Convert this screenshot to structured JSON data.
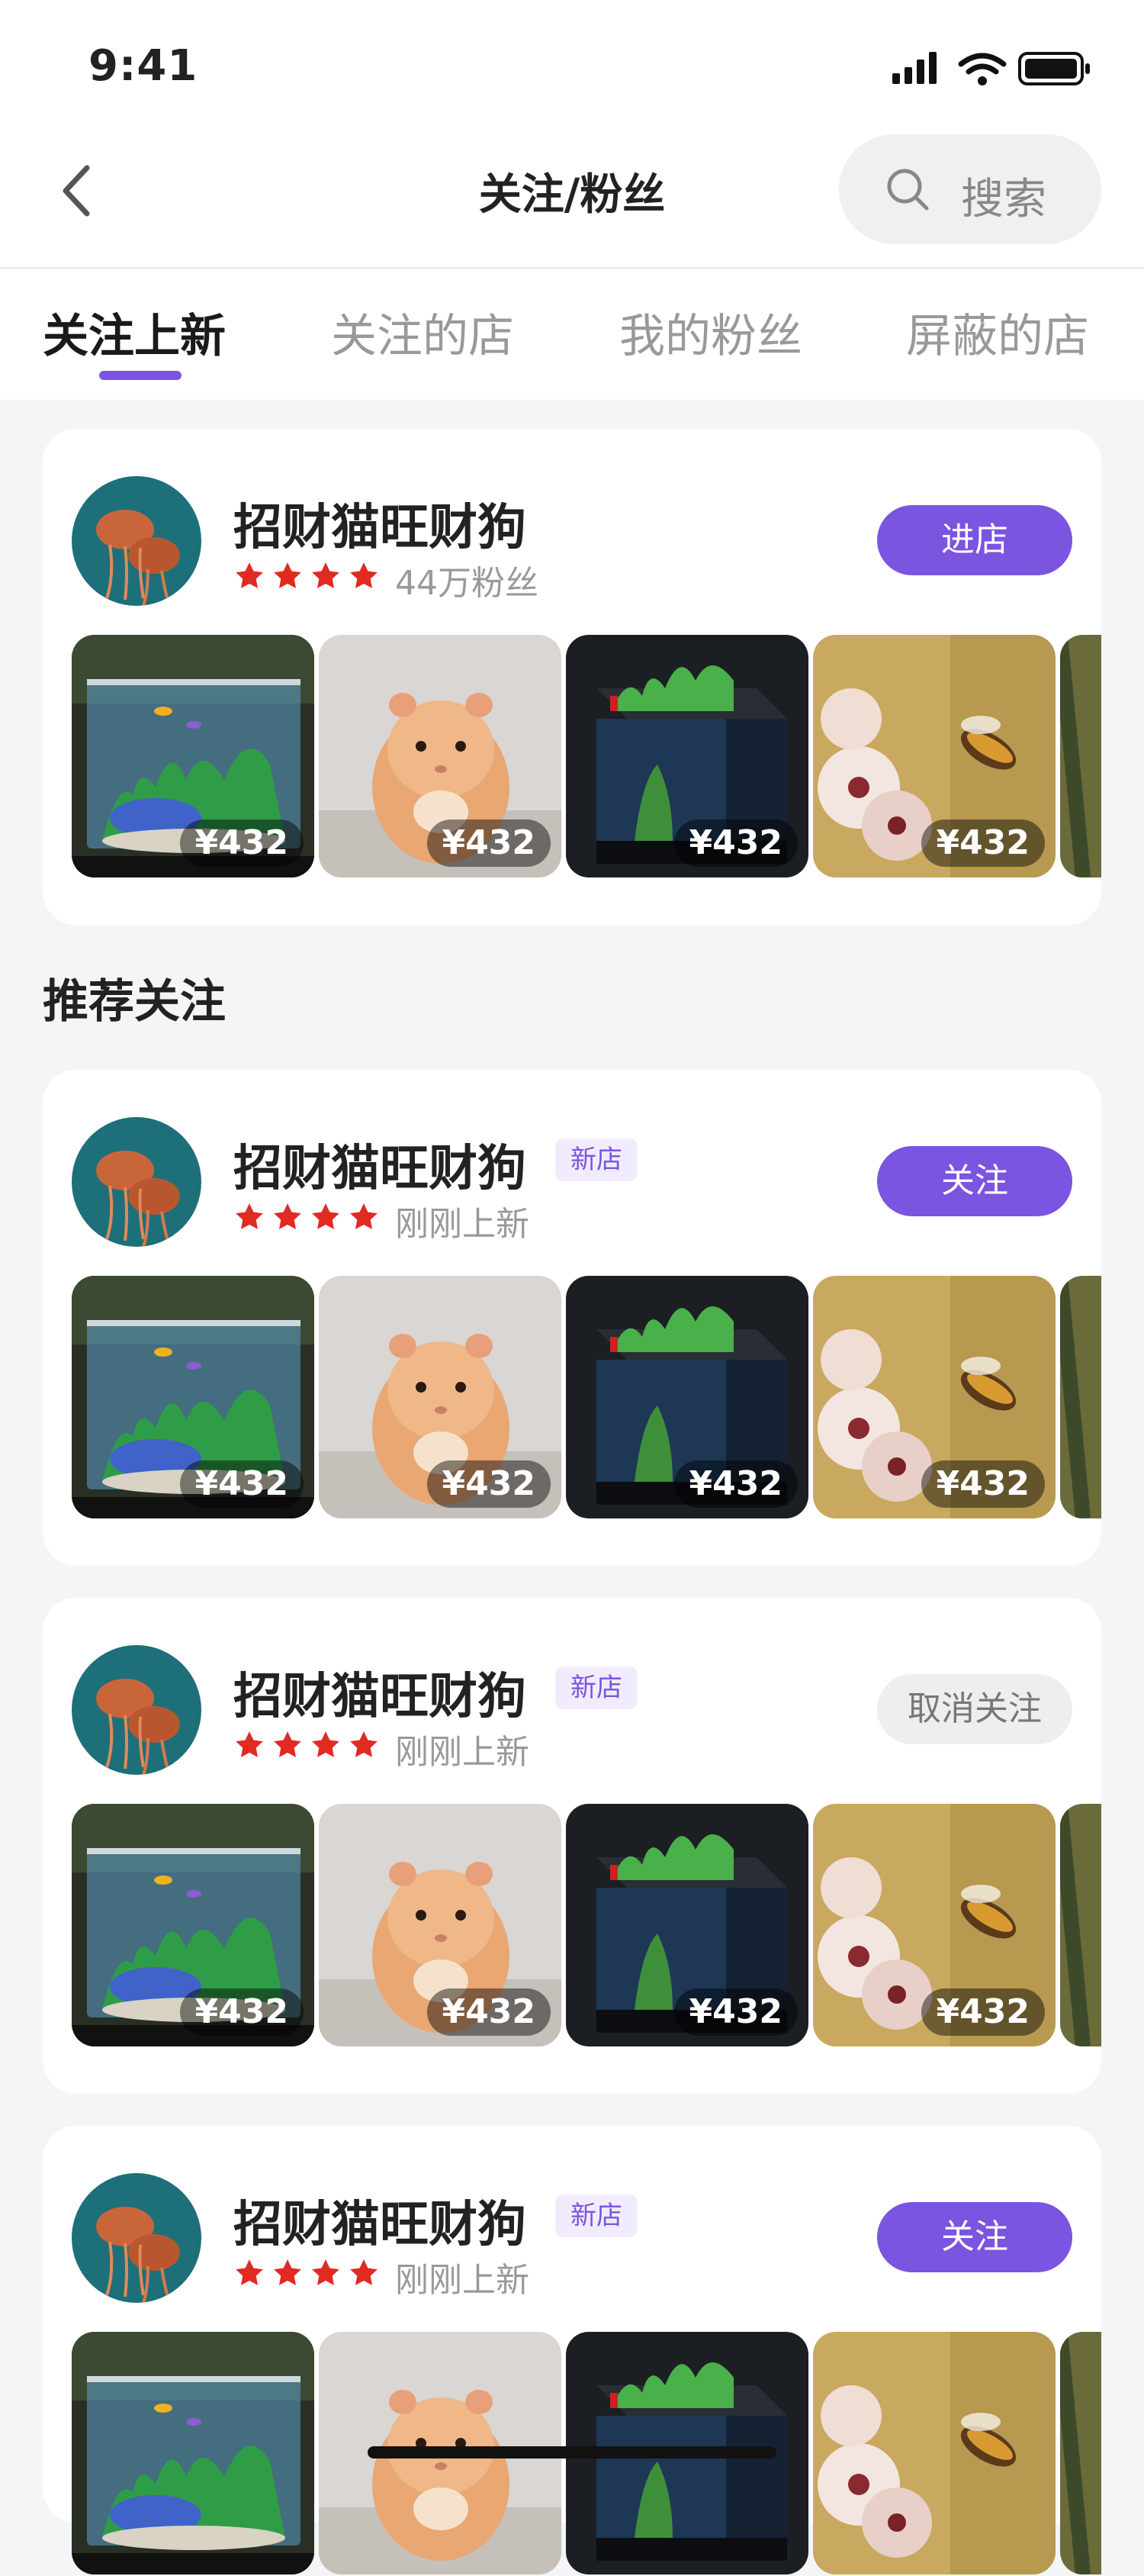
{
  "status": {
    "time": "9:41"
  },
  "nav": {
    "title": "关注/粉丝",
    "search_label": "搜索"
  },
  "tabs": [
    {
      "label": "关注上新"
    },
    {
      "label": "关注的店"
    },
    {
      "label": "我的粉丝"
    },
    {
      "label": "屏蔽的店"
    }
  ],
  "followed_shop": {
    "name": "招财猫旺财狗",
    "stars": 4,
    "meta": "44万粉丝",
    "action": "进店",
    "products": [
      {
        "type": "aquarium",
        "price": "¥432"
      },
      {
        "type": "hamster",
        "price": "¥432"
      },
      {
        "type": "tank",
        "price": "¥432"
      },
      {
        "type": "bee-flower",
        "price": "¥432"
      }
    ]
  },
  "section_title": "推荐关注",
  "recommended": [
    {
      "name": "招财猫旺财狗",
      "badge": "新店",
      "stars": 4,
      "meta": "刚刚上新",
      "action": "关注",
      "action_style": "primary",
      "products": [
        {
          "type": "aquarium",
          "price": "¥432"
        },
        {
          "type": "hamster",
          "price": "¥432"
        },
        {
          "type": "tank",
          "price": "¥432"
        },
        {
          "type": "bee-flower",
          "price": "¥432"
        }
      ]
    },
    {
      "name": "招财猫旺财狗",
      "badge": "新店",
      "stars": 4,
      "meta": "刚刚上新",
      "action": "取消关注",
      "action_style": "secondary",
      "products": [
        {
          "type": "aquarium",
          "price": "¥432"
        },
        {
          "type": "hamster",
          "price": "¥432"
        },
        {
          "type": "tank",
          "price": "¥432"
        },
        {
          "type": "bee-flower",
          "price": "¥432"
        }
      ]
    },
    {
      "name": "招财猫旺财狗",
      "badge": "新店",
      "stars": 4,
      "meta": "刚刚上新",
      "action": "关注",
      "action_style": "primary",
      "products": [
        {
          "type": "aquarium",
          "price": ""
        },
        {
          "type": "hamster",
          "price": ""
        },
        {
          "type": "tank",
          "price": ""
        },
        {
          "type": "bee-flower",
          "price": ""
        }
      ]
    }
  ],
  "colors": {
    "accent": "#7b54e0",
    "star": "#e02a22",
    "background": "#f4f5f6"
  }
}
